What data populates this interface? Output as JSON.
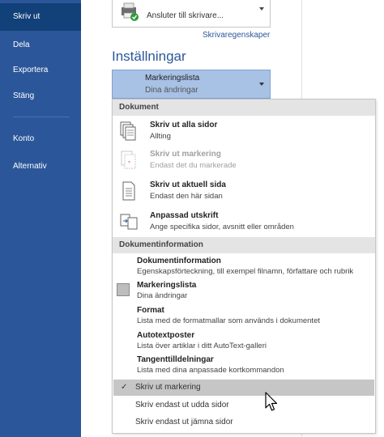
{
  "sidebar": {
    "items": [
      {
        "label": "Skriv ut",
        "active": true
      },
      {
        "label": "Dela"
      },
      {
        "label": "Exportera"
      },
      {
        "label": "Stäng"
      },
      {
        "label": "Konto"
      },
      {
        "label": "Alternativ"
      }
    ]
  },
  "printer": {
    "status": "Ansluter till skrivare...",
    "properties_link": "Skrivaregenskaper"
  },
  "settings": {
    "heading": "Inställningar",
    "selected_title": "Markeringslista",
    "selected_sub": "Dina ändringar"
  },
  "menu": {
    "section_document": "Dokument",
    "section_docinfo": "Dokumentinformation",
    "items": [
      {
        "title": "Skriv ut alla sidor",
        "sub": "Allting",
        "icon": "pages-icon"
      },
      {
        "title": "Skriv ut markering",
        "sub": "Endast det du markerade",
        "icon": "selection-pages-icon",
        "disabled": true
      },
      {
        "title": "Skriv ut aktuell sida",
        "sub": "Endast den här sidan",
        "icon": "single-page-icon"
      },
      {
        "title": "Anpassad utskrift",
        "sub": "Ange specifika sidor, avsnitt eller områden",
        "icon": "custom-print-icon"
      }
    ],
    "info_items": [
      {
        "title": "Dokumentinformation",
        "sub": "Egenskapsförteckning, till exempel filnamn, författare och rubrik"
      },
      {
        "title": "Markeringslista",
        "sub": "Dina ändringar",
        "icon": "markup-swatch-icon"
      },
      {
        "title": "Format",
        "sub": "Lista med de formatmallar som används i dokumentet"
      },
      {
        "title": "Autotextposter",
        "sub": "Lista över artiklar i ditt AutoText-galleri"
      },
      {
        "title": "Tangenttilldelningar",
        "sub": "Lista med dina anpassade kortkommandon"
      }
    ],
    "plain_items": [
      {
        "label": "Skriv ut markering",
        "checked": true,
        "selected": true
      },
      {
        "label": "Skriv endast ut udda sidor"
      },
      {
        "label": "Skriv endast ut jämna sidor"
      }
    ]
  },
  "colors": {
    "accent": "#2b579a",
    "nav_active": "#124078",
    "dropdown_bg": "#a8c2e6"
  }
}
